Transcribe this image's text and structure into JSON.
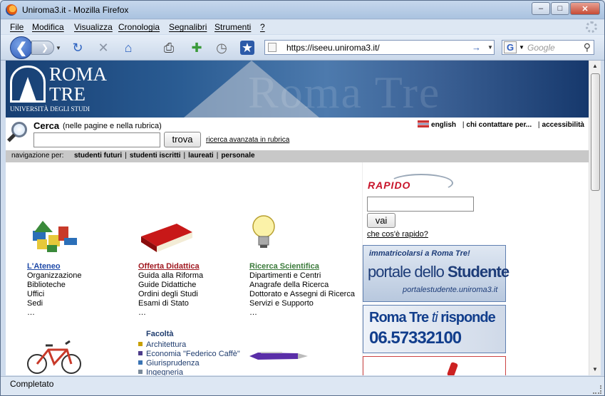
{
  "window": {
    "title": "Uniroma3.it - Mozilla Firefox"
  },
  "menu": [
    "File",
    "Modifica",
    "Visualizza",
    "Cronologia",
    "Segnalibri",
    "Strumenti",
    "?"
  ],
  "address": {
    "url": "https://iseeu.uniroma3.it/"
  },
  "search_engine": {
    "placeholder": "Google"
  },
  "status": {
    "text": "Completato"
  },
  "site": {
    "logo": {
      "line1": "ROMA",
      "line2": "TRE",
      "sub": "UNIVERSITÀ DEGLI STUDI"
    },
    "banner_watermark": "Roma Tre",
    "search": {
      "label": "Cerca",
      "sublabel": "(nelle pagine e nella rubrica)",
      "button": "trova",
      "advanced": "ricerca avanzata in rubrica"
    },
    "toplinks": {
      "english": "english",
      "contact": "chi contattare per...",
      "accessibility": "accessibilità"
    },
    "nav": {
      "lead": "navigazione per:",
      "items": [
        "studenti futuri",
        "studenti iscritti",
        "laureati",
        "personale"
      ]
    },
    "sections": [
      {
        "title": "L'Ateneo",
        "items": [
          "Organizzazione",
          "Biblioteche",
          "Uffici",
          "Sedi",
          "…"
        ],
        "color": "#1f4aa8"
      },
      {
        "title": "Offerta Didattica",
        "items": [
          "Guida alla Riforma",
          "Guide Didattiche",
          "Ordini degli Studi",
          "Esami di Stato",
          "…"
        ],
        "color": "#a01820"
      },
      {
        "title": "Ricerca Scientifica",
        "items": [
          "Dipartimenti e Centri",
          "Anagrafe della Ricerca",
          "Dottorato e Assegni di Ricerca",
          "Servizi e Supporto",
          "…"
        ],
        "color": "#3a7a3a"
      }
    ],
    "facolta": {
      "title": "Facoltà",
      "items": [
        {
          "label": "Architettura",
          "color": "#c8a000"
        },
        {
          "label": "Economia \"Federico Caffè\"",
          "color": "#4d3c8a"
        },
        {
          "label": "Giurisprudenza",
          "color": "#3a74b4"
        },
        {
          "label": "Ingegneria",
          "color": "#7a8a9a"
        }
      ]
    },
    "rapido": {
      "logo": "RAPIDO",
      "button": "vai",
      "help": "che cos'è rapido?"
    },
    "promo1": {
      "line1": "immatricolarsi a Roma Tre!",
      "line2a": "portale dello ",
      "line2b": "Studente",
      "line3": "portalestudente.uniroma3.it"
    },
    "promo2": {
      "line1a": "Roma Tre ",
      "line1b": "ti",
      "line1c": " risponde",
      "line2": "06.57332100"
    }
  }
}
